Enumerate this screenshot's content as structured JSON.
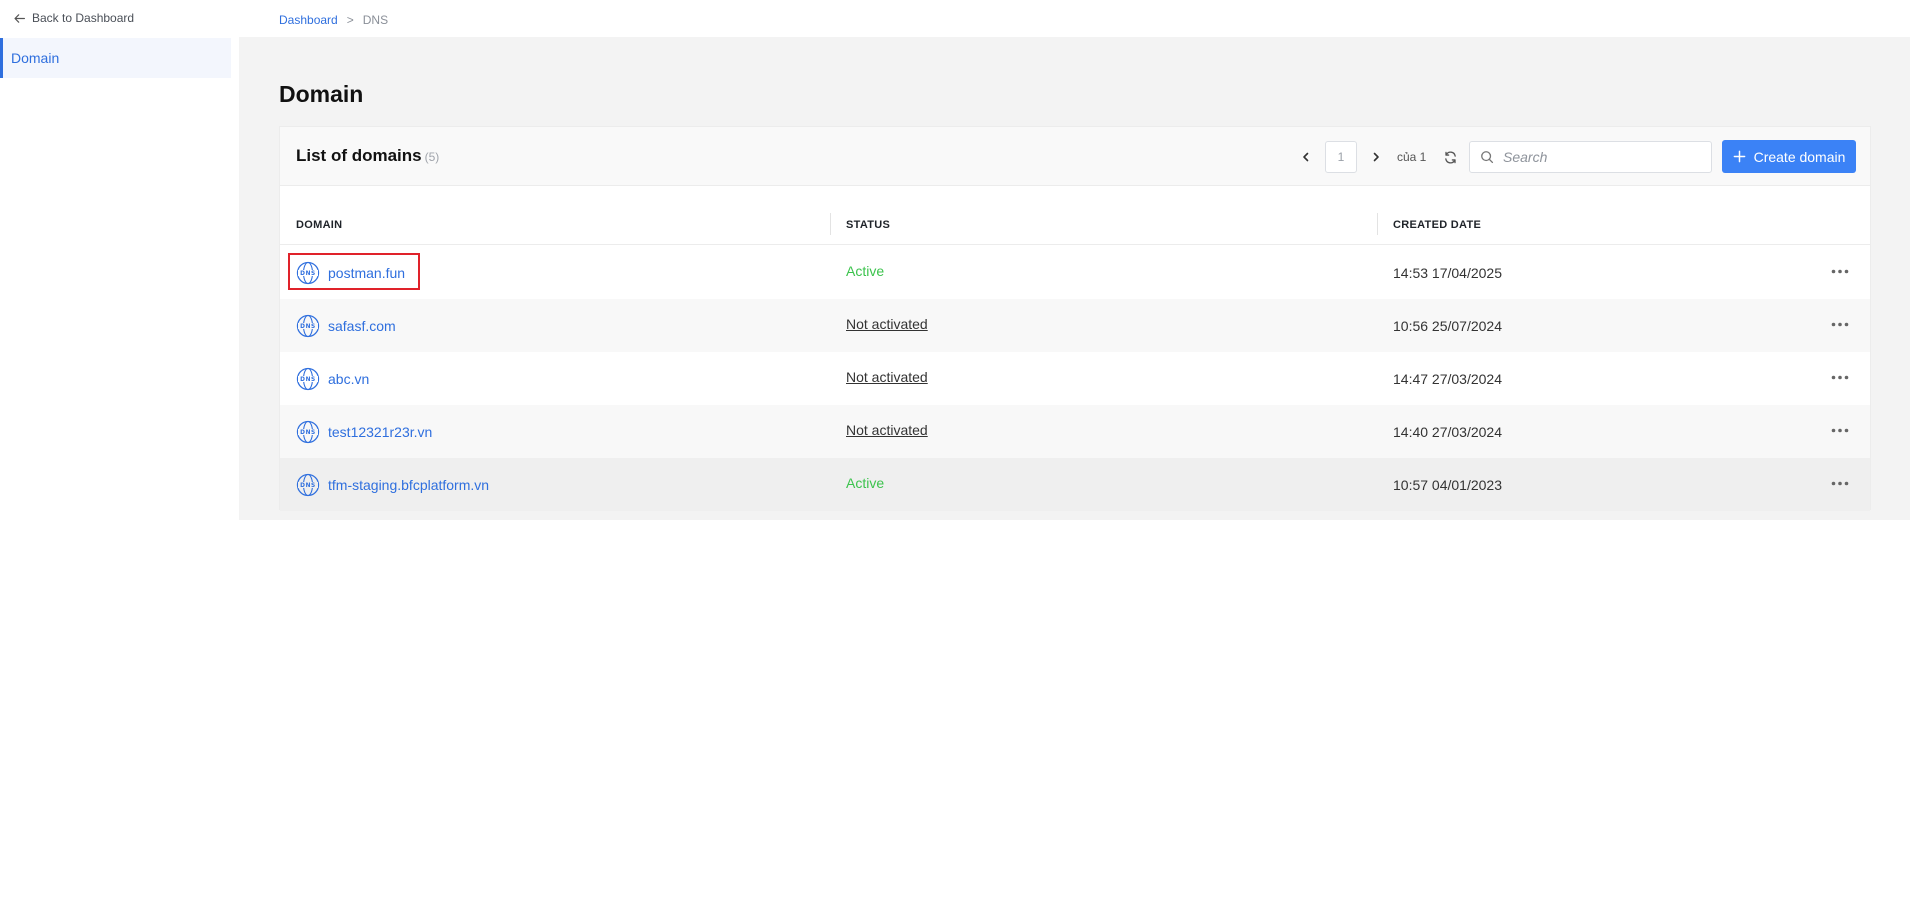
{
  "sidebar": {
    "back_label": "Back to Dashboard",
    "items": [
      {
        "label": "Domain"
      }
    ]
  },
  "breadcrumb": {
    "items": [
      {
        "label": "Dashboard"
      },
      {
        "label": "DNS"
      }
    ],
    "separator": ">"
  },
  "page": {
    "title": "Domain"
  },
  "card": {
    "title": "List of domains",
    "count": "(5)",
    "pager": {
      "page": "1",
      "of_label": "của 1"
    },
    "search_placeholder": "Search",
    "create_label": "Create domain"
  },
  "table": {
    "columns": [
      "DOMAIN",
      "STATUS",
      "CREATED DATE"
    ],
    "rows": [
      {
        "domain": "postman.fun",
        "status": "Active",
        "created": "14:53 17/04/2025"
      },
      {
        "domain": "safasf.com",
        "status": "Not activated",
        "created": "10:56 25/07/2024"
      },
      {
        "domain": "abc.vn",
        "status": "Not activated",
        "created": "14:47 27/03/2024"
      },
      {
        "domain": "test12321r23r.vn",
        "status": "Not activated",
        "created": "14:40 27/03/2024"
      },
      {
        "domain": "tfm-staging.bfcplatform.vn",
        "status": "Active",
        "created": "10:57 04/01/2023"
      }
    ]
  },
  "icons": {
    "back": "arrow-left-icon",
    "prev": "chevron-left-icon",
    "next": "chevron-right-icon",
    "refresh": "refresh-icon",
    "search": "search-icon",
    "create": "plus-icon",
    "domain": "dns-globe-icon",
    "more": "more-horizontal-icon"
  },
  "colors": {
    "accent": "#2f6fde",
    "button": "#3b82f6",
    "active_status": "#3cc34d",
    "highlight": "#e0222a"
  }
}
